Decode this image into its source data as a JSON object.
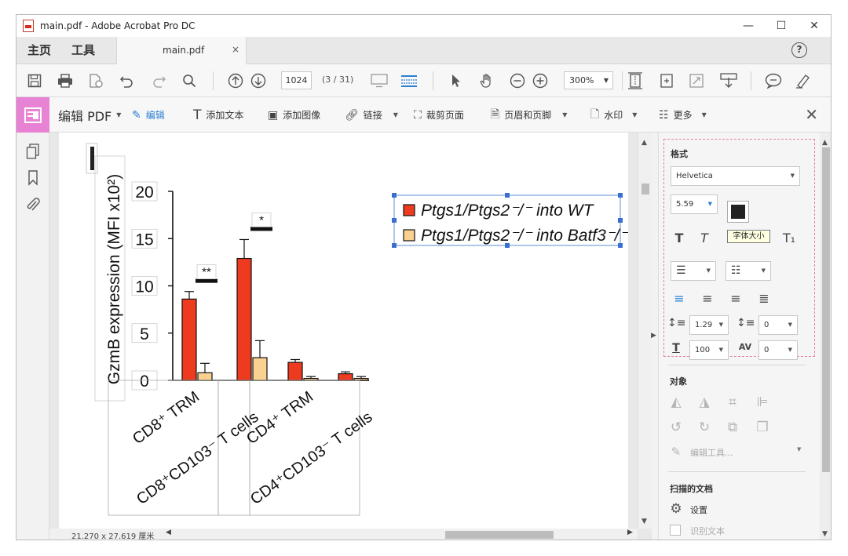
{
  "window": {
    "title": "main.pdf - Adobe Acrobat Pro DC",
    "controls": {
      "minimize": "—",
      "maximize": "☐",
      "close": "✕"
    }
  },
  "tabs": {
    "home": "主页",
    "tools": "工具",
    "document": "main.pdf",
    "close": "×",
    "help": "?"
  },
  "toolbar": {
    "page_number": "1024",
    "page_count": "(3 / 31)",
    "zoom": "300%",
    "icons": [
      "save-icon",
      "print-icon",
      "share-icon",
      "undo-icon",
      "redo-icon",
      "search-icon",
      "page-up-icon",
      "page-down-icon",
      "read-mode-icon",
      "scroll-mode-icon",
      "select-cursor-icon",
      "hand-icon",
      "zoom-out-icon",
      "zoom-in-icon",
      "fit-page-icon",
      "rotate-icon",
      "fullscreen-icon",
      "download-icon",
      "comment-icon",
      "highlight-icon"
    ]
  },
  "editbar": {
    "edit_pdf": "编辑 PDF",
    "edit": "编辑",
    "add_text": "添加文本",
    "add_image": "添加图像",
    "link": "链接",
    "crop": "裁剪页面",
    "header_footer": "页眉和页脚",
    "watermark": "水印",
    "more": "更多"
  },
  "status": {
    "dimensions": "21.270 x 27.619 厘米"
  },
  "right_panel": {
    "format_title": "格式",
    "font": "Helvetica",
    "font_size": "5.59",
    "tooltip": "字体大小",
    "line_spacing": "1.29",
    "para_spacing": "0",
    "h_scale": "100",
    "char_spacing": "0",
    "objects_title": "对象",
    "edit_tools": "编辑工具...",
    "scanned_title": "扫描的文档",
    "settings": "设置",
    "recognize": "识别文本",
    "text_color": "#222222"
  },
  "chart_data": {
    "type": "bar",
    "ylabel": "GzmB expression (MFI x10²)",
    "ylim": [
      0,
      20
    ],
    "yticks": [
      "20",
      "15",
      "10",
      "5",
      "0"
    ],
    "categories": [
      "CD8⁺ TRM",
      "CD8⁺CD103⁻ T cells",
      "CD4⁺ TRM",
      "CD4⁺CD103⁻ T cells"
    ],
    "series": [
      {
        "name": "Ptgs1/Ptgs2⁻/⁻ into WT",
        "color": "#ee3a1f",
        "values": [
          8.6,
          12.9,
          1.9,
          0.7
        ],
        "errors": [
          0.8,
          2.0,
          0.3,
          0.2
        ]
      },
      {
        "name": "Ptgs1/Ptgs2⁻/⁻ into Batf3⁻/⁻",
        "color": "#fbd190",
        "values": [
          0.8,
          2.4,
          0.2,
          0.2
        ],
        "errors": [
          1.0,
          1.8,
          0.2,
          0.2
        ]
      }
    ],
    "significance": [
      "**",
      "*"
    ],
    "legend_position": "top-right"
  }
}
